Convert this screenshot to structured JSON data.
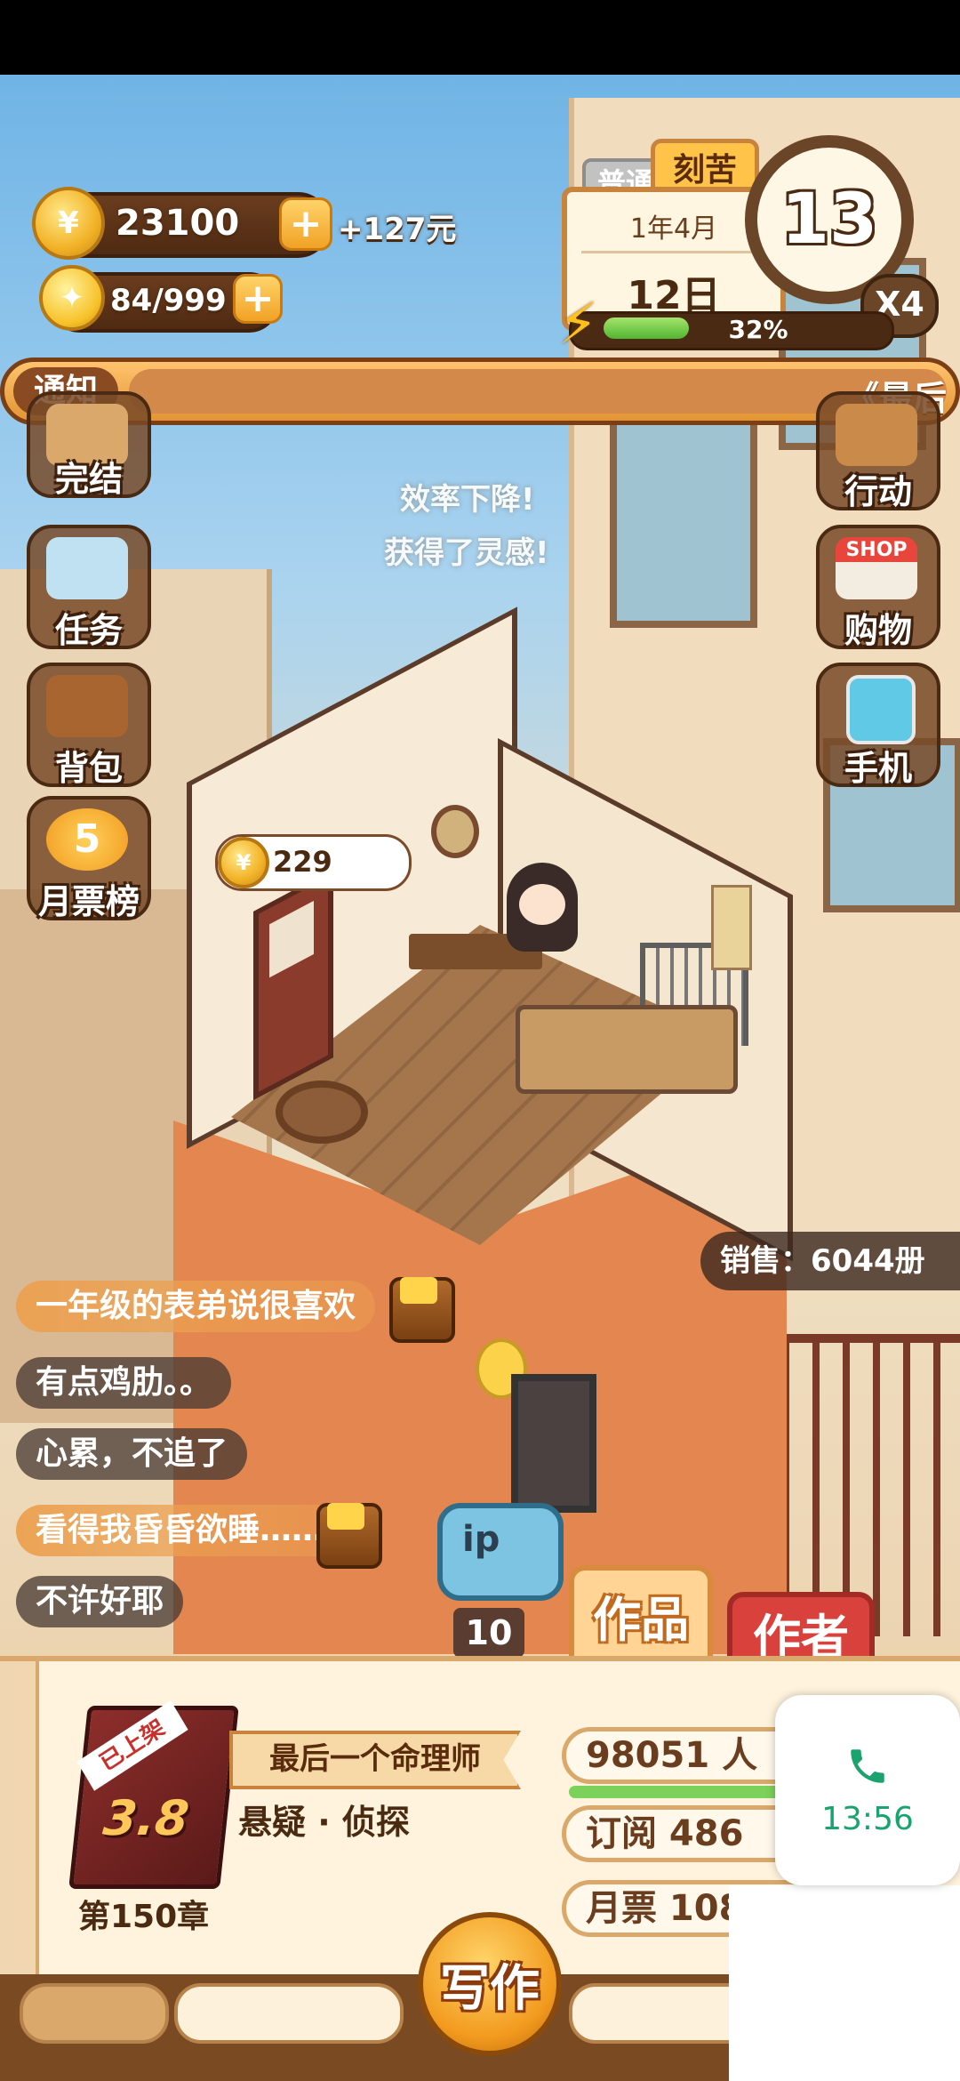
{
  "hud": {
    "coins": "23100",
    "coin_bonus": "+127元",
    "ideas": "84/999",
    "mode_tab_inactive": "普通",
    "mode_tab_active": "刻苦",
    "date_month": "1年4月",
    "date_day": "12日",
    "clock_value": "13",
    "speed": "X4",
    "energy_percent": "32%",
    "energy_fraction": 0.32
  },
  "notice": {
    "tag": "通知",
    "text": "《最后"
  },
  "left_menu": [
    {
      "label": "完结",
      "icon": "book-complete-icon"
    },
    {
      "label": "任务",
      "icon": "clipboard-task-icon"
    },
    {
      "label": "背包",
      "icon": "backpack-icon"
    },
    {
      "label": "月票榜",
      "icon": "monthly-ticket-coin-icon",
      "badge": "5"
    }
  ],
  "right_menu": [
    {
      "label": "行动",
      "icon": "action-arrow-icon"
    },
    {
      "label": "购物",
      "icon": "shop-icon",
      "badge": "SHOP"
    },
    {
      "label": "手机",
      "icon": "phone-icon"
    }
  ],
  "floating_text": {
    "line1": "效率下降!",
    "line2": "获得了灵感!"
  },
  "coin_bubble": "229",
  "sales": "销售：6044册",
  "comments": [
    {
      "text": "一年级的表弟说很喜欢",
      "style": "gold",
      "chest": true
    },
    {
      "text": "有点鸡肋。。",
      "style": "dark",
      "chest": false
    },
    {
      "text": "心累，不追了",
      "style": "dark",
      "chest": false
    },
    {
      "text": "看得我昏昏欲睡……",
      "style": "gold",
      "chest": true
    },
    {
      "text": "不许好耶",
      "style": "dark",
      "chest": false
    }
  ],
  "scene_buttons": {
    "ip": "ip",
    "level": "10",
    "tab_works": "作品",
    "tab_author": "作者"
  },
  "book": {
    "ribbon": "已上架",
    "score": "3.8",
    "title": "最后一个命理师",
    "genre": "悬疑 · 侦探",
    "chapter": "第150章",
    "readers": "98051 人",
    "subscriptions": "订阅 486",
    "monthly_tickets": "月票 108"
  },
  "write_button": "写作",
  "call_widget": {
    "time": "13:56"
  },
  "colors": {
    "accent_orange": "#f29a1e",
    "brown": "#6b3d1f",
    "call_green": "#1aa36f",
    "author_red": "#d9413c"
  }
}
